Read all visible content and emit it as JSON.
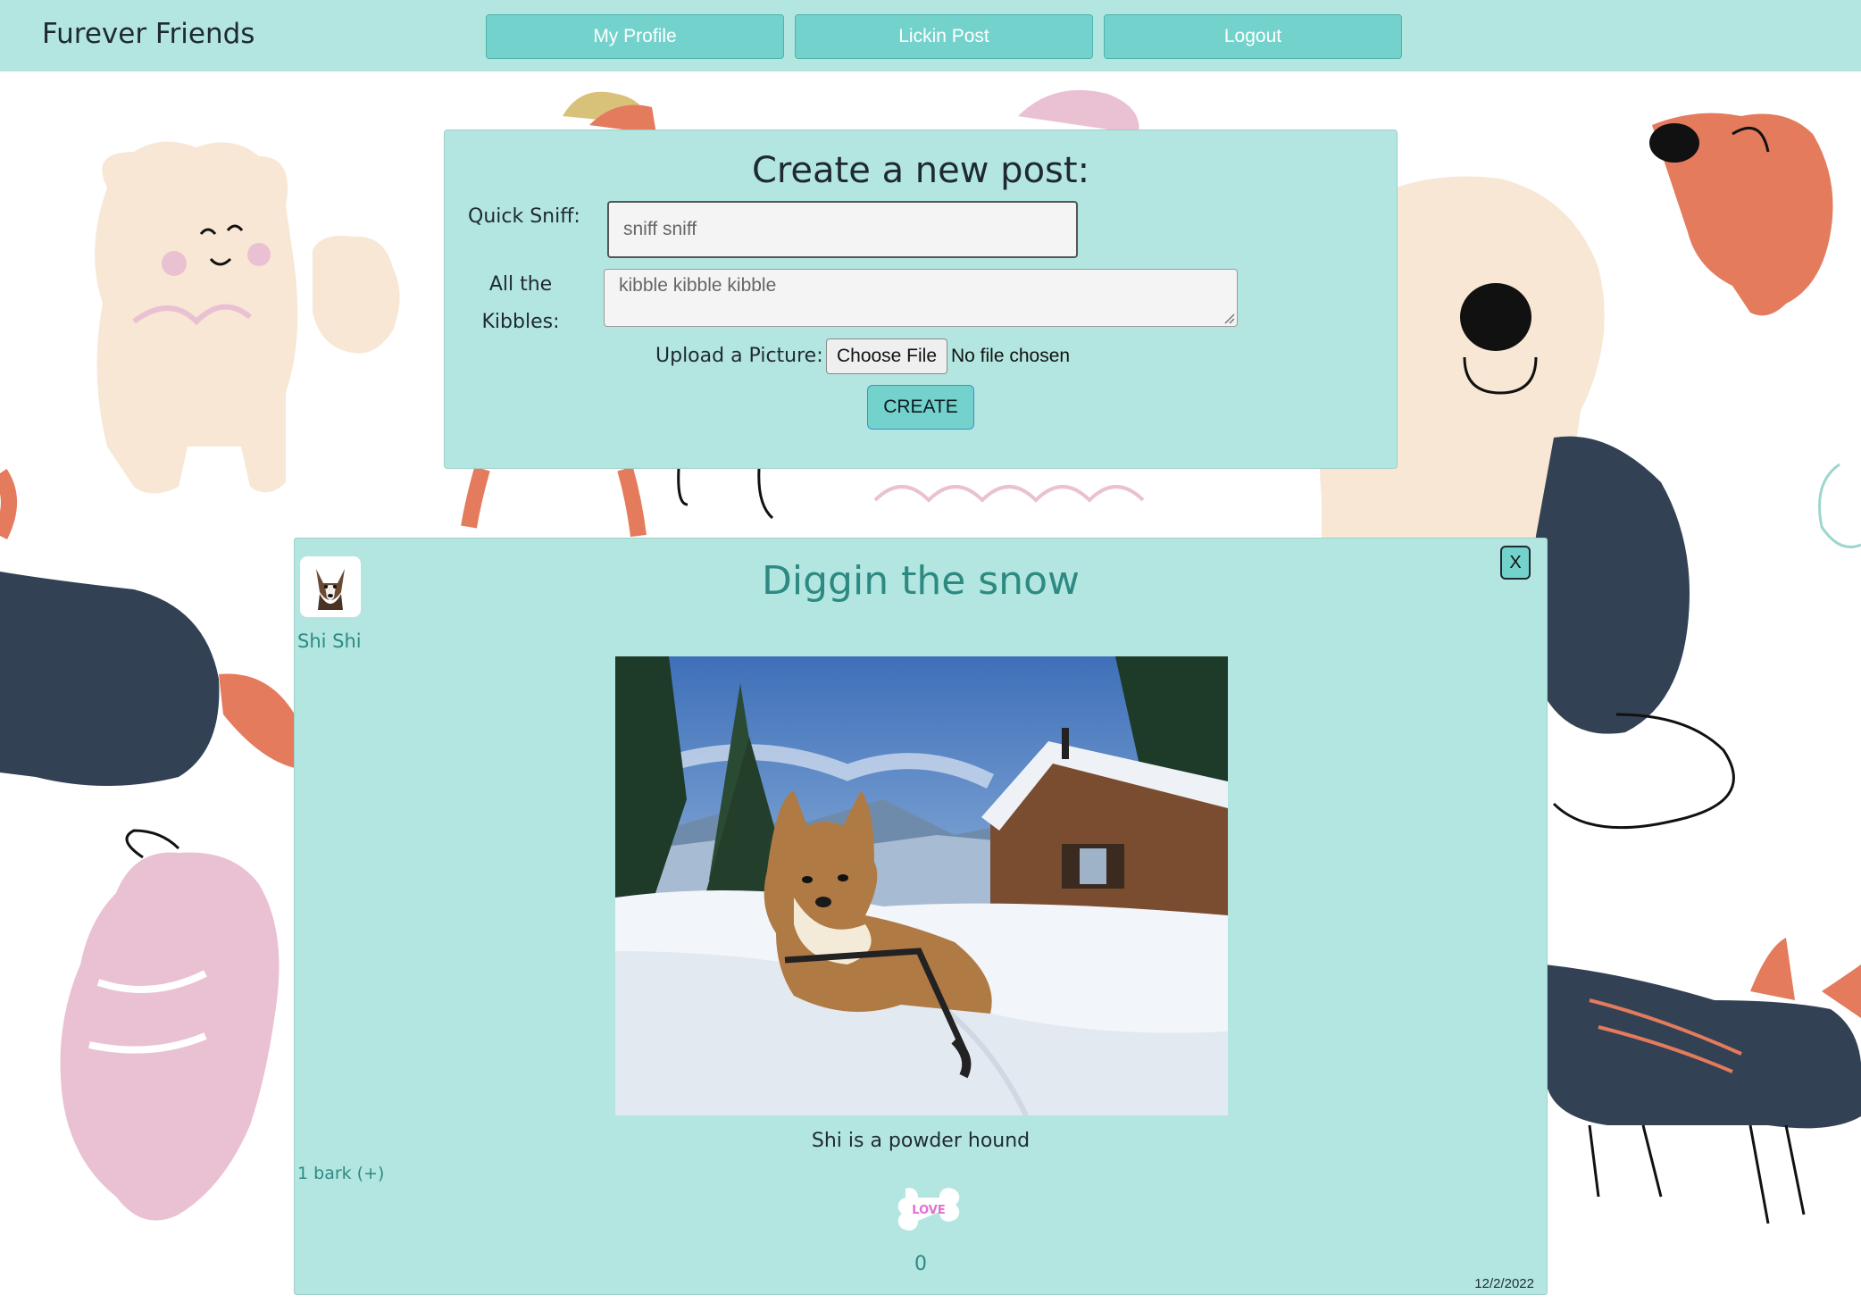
{
  "app": {
    "brand": "Furever Friends"
  },
  "nav": {
    "my_profile": "My Profile",
    "lickin_post": "Lickin Post",
    "logout": "Logout"
  },
  "create_form": {
    "title": "Create a new post:",
    "quick_sniff_label": "Quick Sniff:",
    "quick_sniff_value": "sniff sniff",
    "kibbles_label": "All the Kibbles:",
    "kibbles_value": "kibble kibble kibble",
    "upload_label": "Upload a Picture:",
    "choose_file": "Choose File",
    "file_status": "No file chosen",
    "create_button": "CREATE"
  },
  "post": {
    "close": "X",
    "author": "Shi Shi",
    "title": "Diggin the snow",
    "caption": "Shi is a powder hound",
    "barks": "1 bark (+)",
    "love_label": "LOVE",
    "love_count": "0",
    "date": "12/2/2022"
  },
  "colors": {
    "panel": "#b3e6e0",
    "button": "#73d3cc",
    "accent_text": "#2d8a82"
  },
  "icons": {
    "avatar": "dog-avatar-icon",
    "love": "love-bone-icon",
    "resize": "resize-grip-icon"
  }
}
